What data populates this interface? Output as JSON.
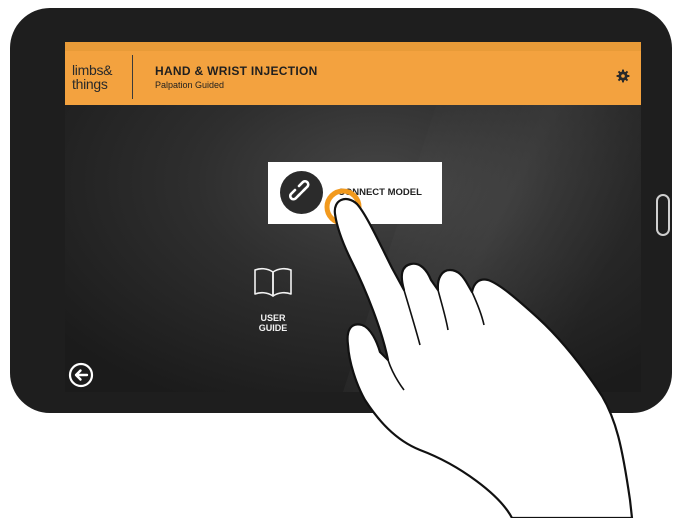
{
  "header": {
    "logo_line1": "limbs&",
    "logo_line2": "things",
    "title": "HAND & WRIST INJECTION",
    "subtitle": "Palpation Guided",
    "settings_icon": "gear-icon"
  },
  "main": {
    "connect_label": "CONNECT MODEL",
    "connect_icon": "link-icon",
    "guide_line1": "USER",
    "guide_line2": "GUIDE",
    "guide_icon": "book-icon",
    "back_icon": "back-arrow-icon"
  },
  "colors": {
    "accent": "#f3a23f",
    "touch_ring": "#f29a1e",
    "tablet": "#1e1e1e",
    "screen_bg": "#2e2e2e"
  }
}
